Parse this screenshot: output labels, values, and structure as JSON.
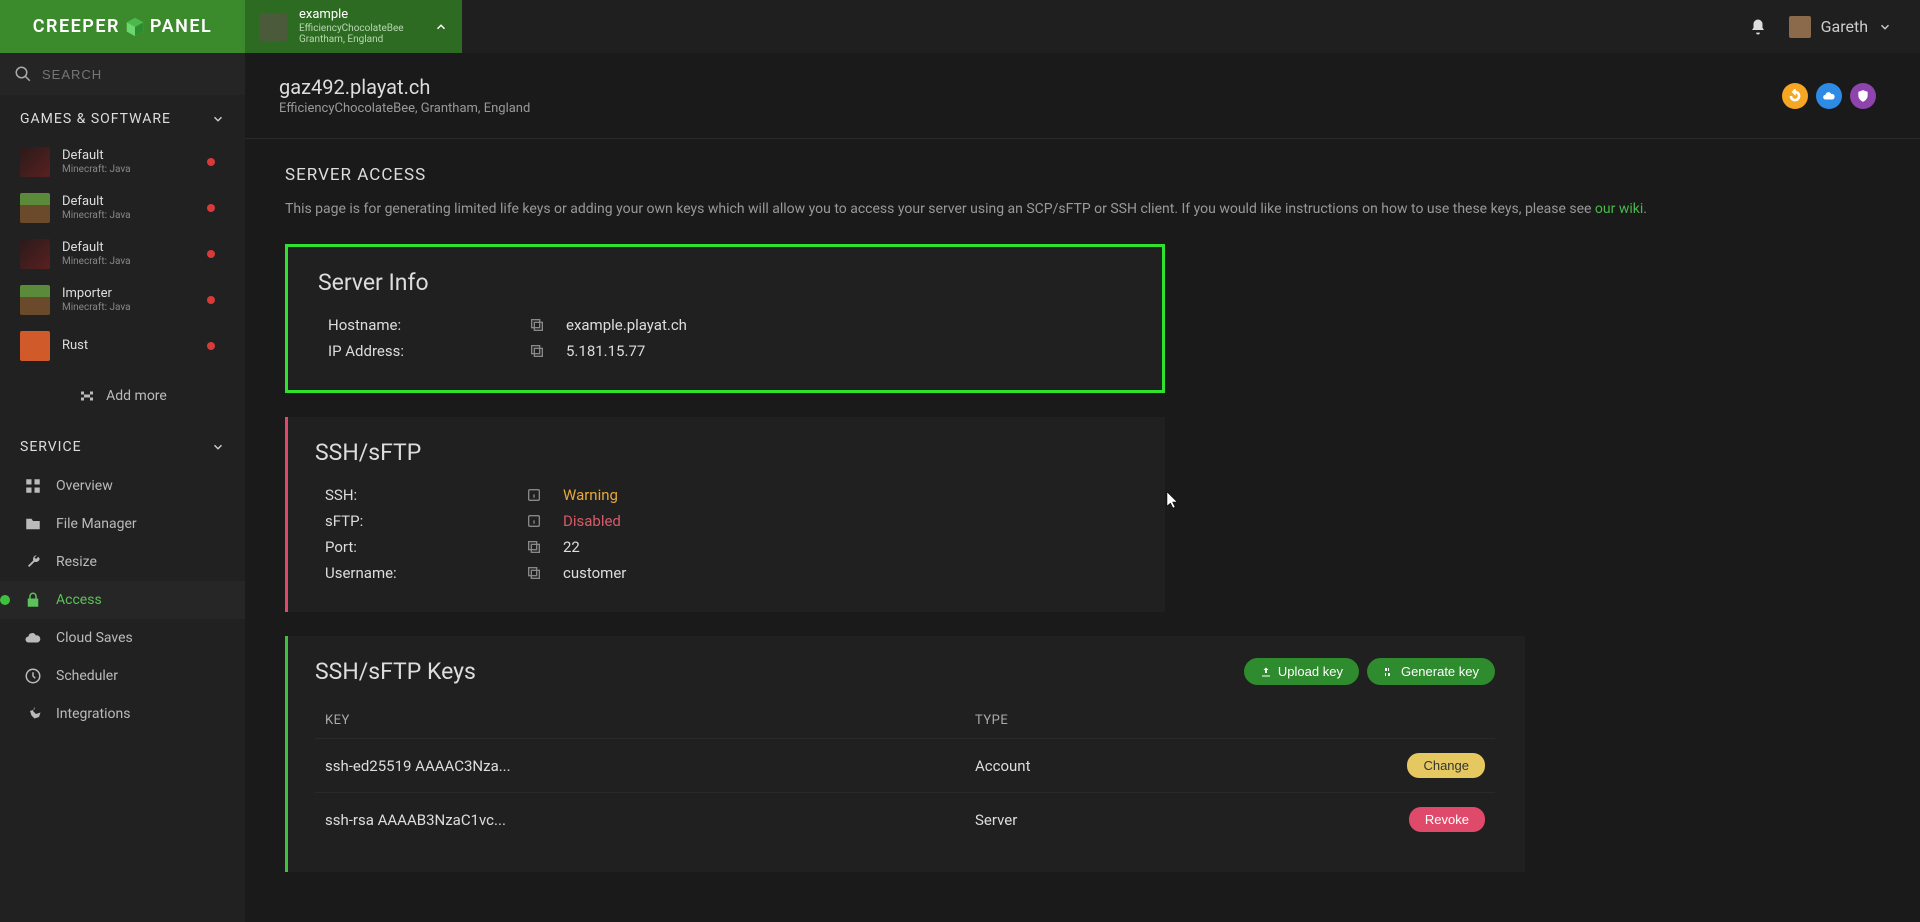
{
  "brand": {
    "left": "CREEPER",
    "right": "PANEL"
  },
  "selector": {
    "name": "example",
    "subtitle1": "EfficiencyChocolateBee",
    "subtitle2": "Grantham, England"
  },
  "user": {
    "name": "Gareth"
  },
  "search": {
    "placeholder": "SEARCH"
  },
  "sidebar": {
    "games_header": "GAMES & SOFTWARE",
    "games": [
      {
        "name": "Default",
        "sub": "Minecraft: Java",
        "thumb": "forge"
      },
      {
        "name": "Default",
        "sub": "Minecraft: Java",
        "thumb": "grass"
      },
      {
        "name": "Default",
        "sub": "Minecraft: Java",
        "thumb": "forge"
      },
      {
        "name": "Importer",
        "sub": "Minecraft: Java",
        "thumb": "grass"
      },
      {
        "name": "Rust",
        "sub": "",
        "thumb": "rust"
      }
    ],
    "add_more": "Add more",
    "service_header": "SERVICE",
    "services": [
      {
        "slug": "overview",
        "label": "Overview",
        "icon": "grid"
      },
      {
        "slug": "file-manager",
        "label": "File Manager",
        "icon": "folder"
      },
      {
        "slug": "resize",
        "label": "Resize",
        "icon": "wrench"
      },
      {
        "slug": "access",
        "label": "Access",
        "icon": "lock",
        "active": true
      },
      {
        "slug": "cloud-saves",
        "label": "Cloud Saves",
        "icon": "cloud"
      },
      {
        "slug": "scheduler",
        "label": "Scheduler",
        "icon": "clock"
      },
      {
        "slug": "integrations",
        "label": "Integrations",
        "icon": "tool"
      }
    ]
  },
  "page": {
    "title": "gaz492.playat.ch",
    "subtitle": "EfficiencyChocolateBee, Grantham, England"
  },
  "access": {
    "heading": "SERVER ACCESS",
    "desc_pre": "This page is for generating limited life keys or adding your own keys which will allow you to access your server using an SCP/sFTP or SSH client. If you would like instructions on how to use these keys, please see ",
    "wiki_link": "our wiki",
    "desc_post": "."
  },
  "server_info": {
    "title": "Server Info",
    "rows": [
      {
        "label": "Hostname:",
        "value": "example.playat.ch",
        "icon": "copy"
      },
      {
        "label": "IP Address:",
        "value": "5.181.15.77",
        "icon": "copy"
      }
    ]
  },
  "ssh": {
    "title": "SSH/sFTP",
    "rows": [
      {
        "label": "SSH:",
        "value": "Warning",
        "cls": "val-warning",
        "icon": "info"
      },
      {
        "label": "sFTP:",
        "value": "Disabled",
        "cls": "val-disabled",
        "icon": "info"
      },
      {
        "label": "Port:",
        "value": "22",
        "cls": "",
        "icon": "copy"
      },
      {
        "label": "Username:",
        "value": "customer",
        "cls": "",
        "icon": "copy"
      }
    ]
  },
  "keys": {
    "title": "SSH/sFTP Keys",
    "upload_btn": "Upload key",
    "generate_btn": "Generate key",
    "head_key": "KEY",
    "head_type": "TYPE",
    "rows": [
      {
        "key": "ssh-ed25519 AAAAC3Nza...",
        "type": "Account",
        "action": "Change",
        "btn_cls": "btn-yellow"
      },
      {
        "key": "ssh-rsa AAAAB3NzaC1vc...",
        "type": "Server",
        "action": "Revoke",
        "btn_cls": "btn-red"
      }
    ]
  }
}
